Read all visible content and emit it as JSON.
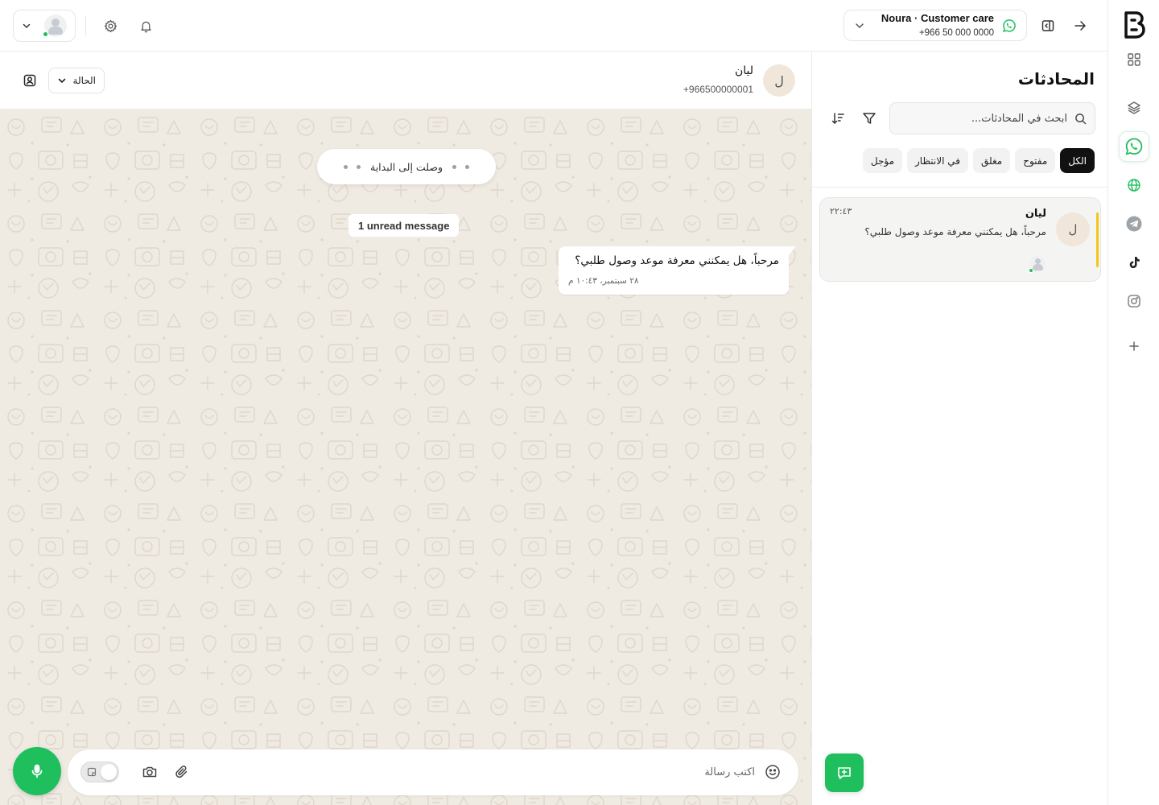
{
  "colors": {
    "accent_green": "#1fbf5d",
    "chat_background": "#efeae2",
    "unread_accent": "#f5c518",
    "active_chip": "#111111"
  },
  "rail": {
    "items": [
      {
        "icon": "grid-icon"
      },
      {
        "icon": "layers-icon"
      },
      {
        "icon": "whatsapp-icon",
        "active": true
      },
      {
        "icon": "globe-icon"
      },
      {
        "icon": "telegram-icon"
      },
      {
        "icon": "tiktok-icon"
      },
      {
        "icon": "instagram-icon"
      },
      {
        "icon": "plus-icon"
      }
    ]
  },
  "topbar": {
    "channel_name": "Noura · Customer care",
    "channel_phone": "+966 50 000 0000"
  },
  "conversations": {
    "title": "المحادثات",
    "search_placeholder": "ابحث في المحادثات...",
    "filters": [
      "الكل",
      "مفتوح",
      "مغلق",
      "في الانتظار",
      "مؤجل"
    ],
    "active_filter": "الكل",
    "items": [
      {
        "initial": "ل",
        "name": "ليان",
        "time": "٢٢:٤٣",
        "preview": "مرحباً، هل يمكنني معرفة موعد وصول طلبي؟",
        "unread": true
      }
    ]
  },
  "chat": {
    "contact_initial": "ل",
    "contact_name": "ليان",
    "contact_phone": "+966500000001",
    "status_label": "الحالة",
    "reached_start": "وصلت إلى البداية",
    "unread_banner": "1 unread message",
    "messages": [
      {
        "text": "مرحباً، هل يمكنني معرفة موعد وصول طلبي؟",
        "time": "٢٨ سبتمبر، ١٠:٤٣ م",
        "direction": "incoming"
      }
    ]
  },
  "composer": {
    "placeholder": "اكتب رسالة"
  }
}
